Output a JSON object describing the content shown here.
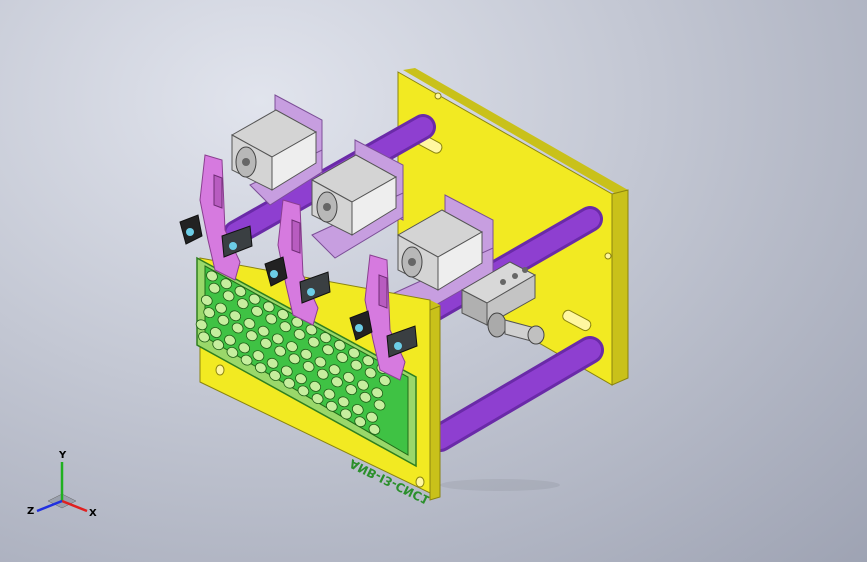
{
  "viewport": {
    "background_top": "#e1e4ed",
    "background_bottom": "#9ea3b3"
  },
  "model": {
    "engraved_text": "ANB-I3-CNC1",
    "colors": {
      "plate_yellow": "#f2ea22",
      "plate_yellow_side": "#c9c11a",
      "rod_purple": "#8e3fd0",
      "bracket_lavender": "#c79ee0",
      "clamp_magenta": "#d67adf",
      "motor_grey": "#d4d4d4",
      "cylinder_grey": "#c8c8c8",
      "fixture_green": "#3fc244",
      "block_grey": "#8a9094"
    }
  },
  "triad": {
    "x_label": "X",
    "y_label": "Y",
    "z_label": "Z",
    "x_color": "#e02020",
    "y_color": "#20b020",
    "z_color": "#2030e0"
  }
}
